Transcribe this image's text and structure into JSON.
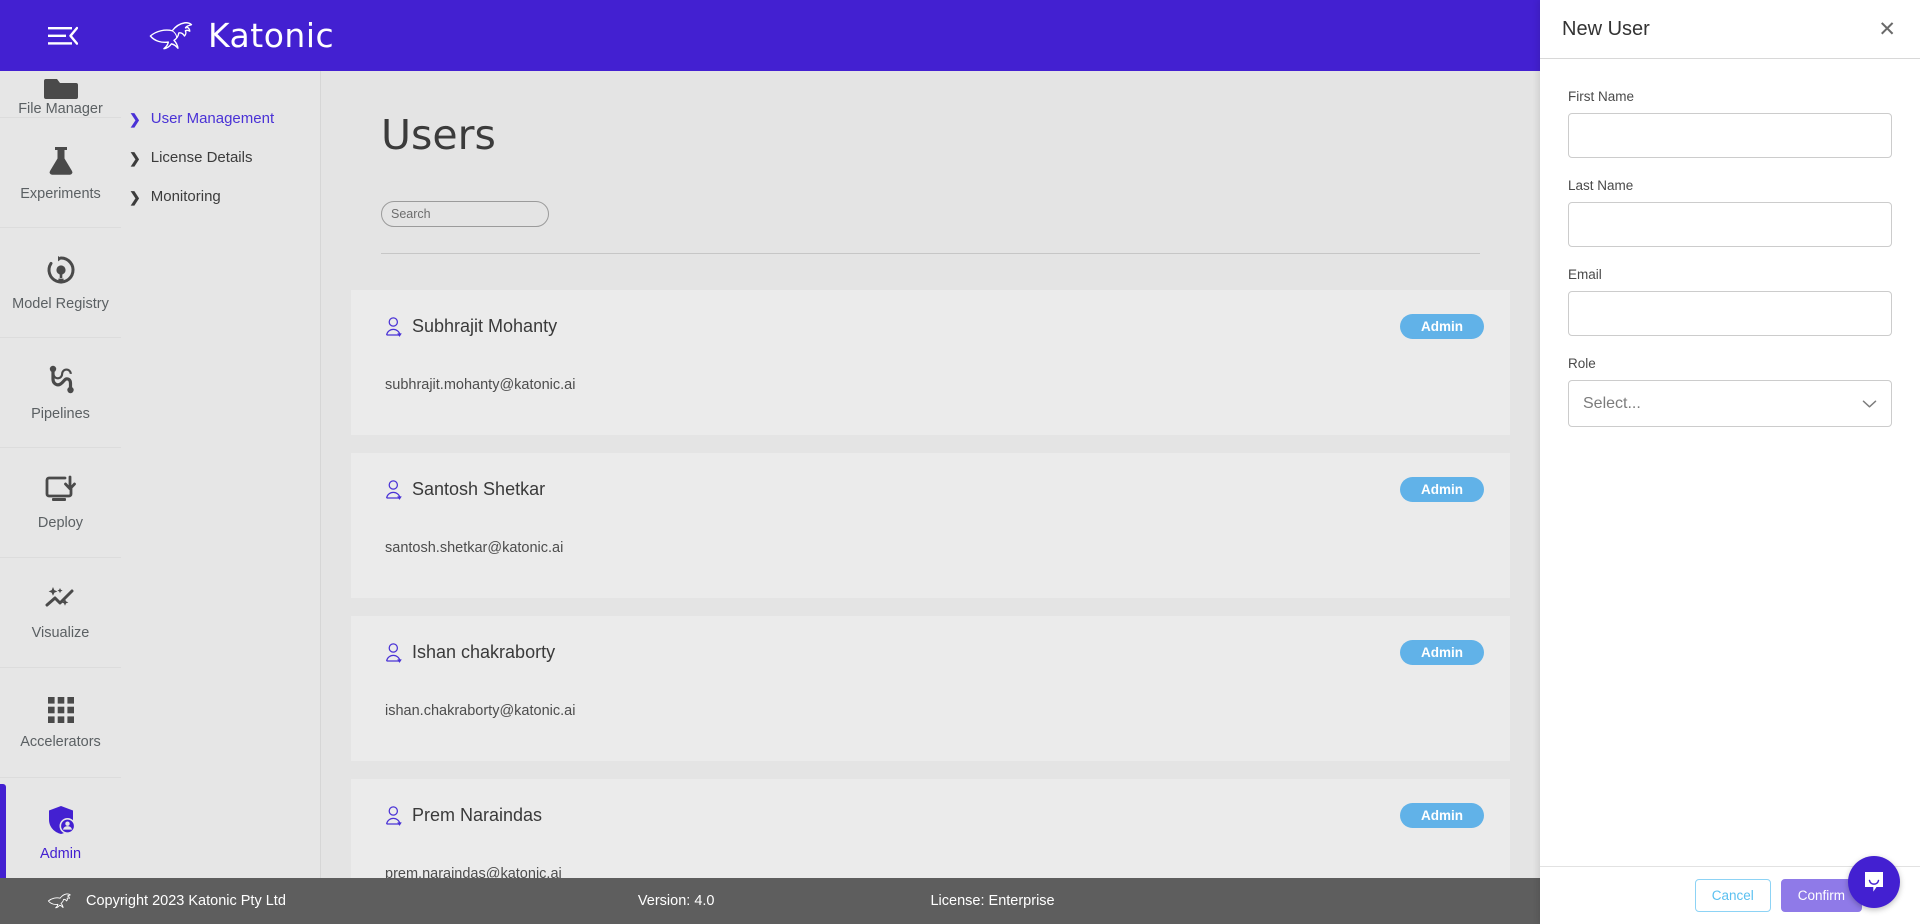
{
  "header": {
    "brand": "Katonic",
    "menu_icon": "hamburger-collapse-icon",
    "logo_icon": "kangaroo-logo-icon"
  },
  "rail": {
    "items": [
      {
        "label": "File Manager",
        "icon": "folder-icon",
        "active": false
      },
      {
        "label": "Experiments",
        "icon": "flask-icon",
        "active": false
      },
      {
        "label": "Model Registry",
        "icon": "model-registry-icon",
        "active": false
      },
      {
        "label": "Pipelines",
        "icon": "pipelines-icon",
        "active": false
      },
      {
        "label": "Deploy",
        "icon": "deploy-icon",
        "active": false
      },
      {
        "label": "Visualize",
        "icon": "visualize-icon",
        "active": false
      },
      {
        "label": "Accelerators",
        "icon": "grid-icon",
        "active": false
      },
      {
        "label": "Admin",
        "icon": "shield-user-icon",
        "active": true
      }
    ]
  },
  "subnav": {
    "items": [
      {
        "label": "User Management",
        "active": true
      },
      {
        "label": "License Details",
        "active": false
      },
      {
        "label": "Monitoring",
        "active": false
      }
    ]
  },
  "main": {
    "title": "Users",
    "search": {
      "value": "",
      "placeholder": "Search",
      "icon": "search-icon"
    },
    "users": [
      {
        "name": "Subhrajit Mohanty",
        "email": "subhrajit.mohanty@katonic.ai",
        "role": "Admin"
      },
      {
        "name": "Santosh Shetkar",
        "email": "santosh.shetkar@katonic.ai",
        "role": "Admin"
      },
      {
        "name": "Ishan chakraborty",
        "email": "ishan.chakraborty@katonic.ai",
        "role": "Admin"
      },
      {
        "name": "Prem Naraindas",
        "email": "prem.naraindas@katonic.ai",
        "role": "Admin"
      }
    ]
  },
  "footer": {
    "copyright": "Copyright 2023 Katonic Pty Ltd",
    "version": "Version: 4.0",
    "license": "License: Enterprise"
  },
  "drawer": {
    "title": "New User",
    "close_icon": "close-icon",
    "fields": [
      {
        "label": "First Name",
        "value": "",
        "placeholder": ""
      },
      {
        "label": "Last Name",
        "value": "",
        "placeholder": ""
      },
      {
        "label": "Email",
        "value": "",
        "placeholder": ""
      }
    ],
    "role": {
      "label": "Role",
      "value": "Select...",
      "chevron": "chevron-down-icon"
    },
    "cancel_label": "Cancel",
    "confirm_label": "Confirm"
  },
  "chat": {
    "icon": "chat-bubble-icon"
  },
  "colors": {
    "brand_purple": "#4320d1",
    "badge_blue": "#61b2e8",
    "confirm_purple": "#8f7ae8",
    "cancel_blue": "#5bc0f0",
    "page_bg": "#e4e4e4",
    "footer_gray": "#5e5e5e"
  }
}
